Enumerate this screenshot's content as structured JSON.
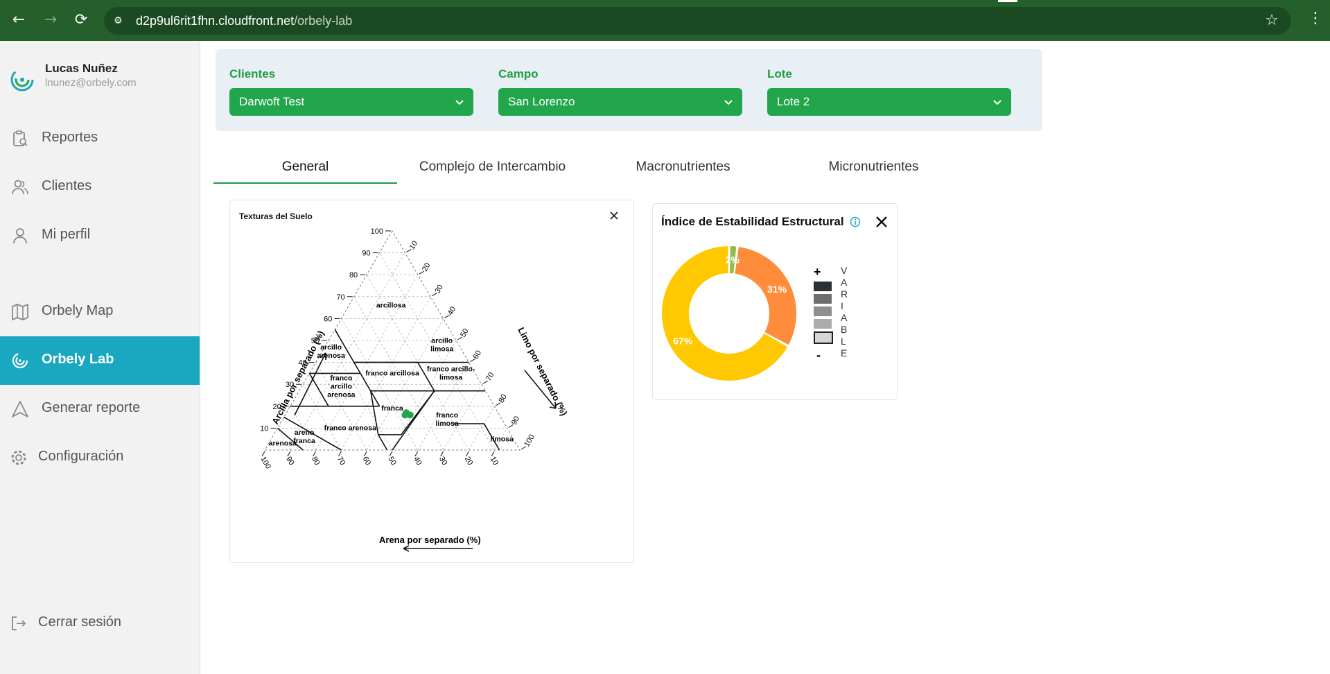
{
  "browser": {
    "url_host": "d2p9ul6rit1fhn.cloudfront.net",
    "url_path": "/orbely-lab"
  },
  "user": {
    "name": "Lucas Nuñez",
    "email": "lnunez@orbely.com"
  },
  "sidebar": {
    "items": [
      {
        "label": "Reportes",
        "icon": "report-icon"
      },
      {
        "label": "Clientes",
        "icon": "users-icon"
      },
      {
        "label": "Mi perfil",
        "icon": "user-icon"
      },
      {
        "label": "Orbely Map",
        "icon": "map-icon"
      },
      {
        "label": "Orbely Lab",
        "icon": "lab-icon",
        "active": true
      },
      {
        "label": "Generar reporte",
        "icon": "triangle-icon"
      },
      {
        "label": "Configuración",
        "icon": "gear-icon"
      }
    ],
    "logout_label": "Cerrar sesión"
  },
  "filters": {
    "clientes": {
      "label": "Clientes",
      "value": "Darwoft Test"
    },
    "campo": {
      "label": "Campo",
      "value": "San Lorenzo"
    },
    "lote": {
      "label": "Lote",
      "value": "Lote 2"
    }
  },
  "tabs": [
    "General",
    "Complejo de Intercambio",
    "Macronutrientes",
    "Micronutrientes"
  ],
  "texture_card": {
    "title": "Texturas del Suelo",
    "left_axis_label": "Arcilla por separado (%)",
    "right_axis_label": "Limo por separado (%)",
    "bottom_axis_label": "Arena por separado (%)",
    "clay_ticks": [
      "10",
      "20",
      "30",
      "40",
      "50",
      "60",
      "70",
      "80",
      "90",
      "100"
    ],
    "silt_ticks": [
      "10",
      "20",
      "30",
      "40",
      "50",
      "60",
      "70",
      "80",
      "90",
      "100"
    ],
    "sand_ticks": [
      "100",
      "90",
      "80",
      "70",
      "60",
      "50",
      "40",
      "30",
      "20",
      "10"
    ],
    "regions": [
      {
        "lines": [
          "arcillosa"
        ]
      },
      {
        "lines": [
          "arcillo",
          "limosa"
        ]
      },
      {
        "lines": [
          "arcillo",
          "arenosa"
        ]
      },
      {
        "lines": [
          "franco arcillosa"
        ]
      },
      {
        "lines": [
          "franco arcillo-",
          "limosa"
        ]
      },
      {
        "lines": [
          "franco",
          "arcillo",
          "arenosa"
        ]
      },
      {
        "lines": [
          "franca"
        ]
      },
      {
        "lines": [
          "franco",
          "limosa"
        ]
      },
      {
        "lines": [
          "franco arenosa"
        ]
      },
      {
        "lines": [
          "limosa"
        ]
      },
      {
        "lines": [
          "areno",
          "franca"
        ]
      },
      {
        "lines": [
          "arenosa"
        ]
      }
    ],
    "samples": [
      {
        "sand": 37,
        "clay": 16
      },
      {
        "sand": 36,
        "clay": 17
      },
      {
        "sand": 35,
        "clay": 16
      }
    ],
    "sample_color": "#22a64b"
  },
  "stability_card": {
    "title": "Índice de Estabilidad Estructural",
    "legend_plus": "+",
    "legend_minus": "-",
    "legend_word": [
      "V",
      "A",
      "R",
      "I",
      "A",
      "B",
      "L",
      "E"
    ]
  },
  "chart_data": {
    "type": "pie",
    "labels": [
      "2%",
      "31%",
      "67%"
    ],
    "values": [
      2,
      31,
      67
    ],
    "colors": [
      "#8fbf4a",
      "#ff8c3a",
      "#ffc800"
    ]
  },
  "colors": {
    "accent_green": "#22a64b",
    "active_nav": "#19a8c0",
    "legend_shades": [
      "#2b2f36",
      "#6e6e6e",
      "#8e8e8e",
      "#ababab",
      "#d6d6d6"
    ]
  }
}
